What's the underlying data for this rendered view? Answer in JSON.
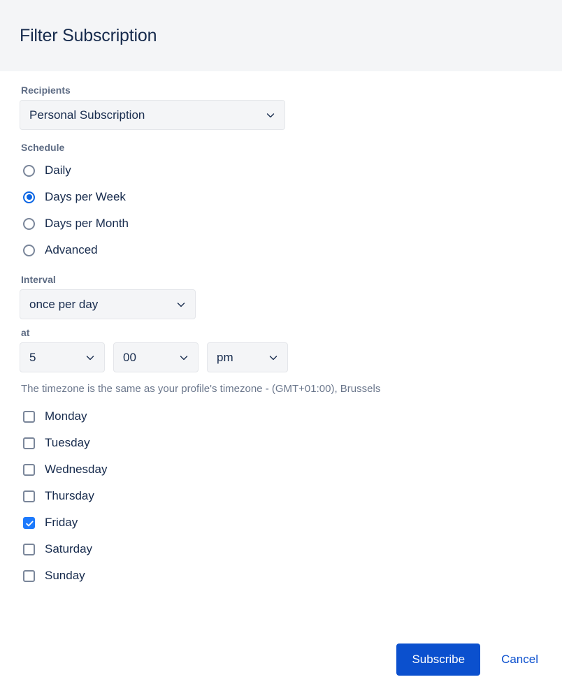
{
  "dialog": {
    "title": "Filter Subscription"
  },
  "recipients": {
    "label": "Recipients",
    "value": "Personal Subscription",
    "options": [
      "Personal Subscription"
    ]
  },
  "schedule": {
    "label": "Schedule",
    "selected": "Days per Week",
    "options": [
      {
        "label": "Daily",
        "checked": false
      },
      {
        "label": "Days per Week",
        "checked": true
      },
      {
        "label": "Days per Month",
        "checked": false
      },
      {
        "label": "Advanced",
        "checked": false
      }
    ]
  },
  "interval": {
    "label": "Interval",
    "value": "once per day",
    "options": [
      "once per day"
    ]
  },
  "time": {
    "label": "at",
    "hour": "5",
    "minute": "00",
    "meridiem": "pm",
    "hour_options": [
      "5"
    ],
    "minute_options": [
      "00"
    ],
    "meridiem_options": [
      "pm"
    ]
  },
  "timezone_note": "The timezone is the same as your profile's timezone - (GMT+01:00), Brussels",
  "days": [
    {
      "label": "Monday",
      "checked": false
    },
    {
      "label": "Tuesday",
      "checked": false
    },
    {
      "label": "Wednesday",
      "checked": false
    },
    {
      "label": "Thursday",
      "checked": false
    },
    {
      "label": "Friday",
      "checked": true
    },
    {
      "label": "Saturday",
      "checked": false
    },
    {
      "label": "Sunday",
      "checked": false
    }
  ],
  "footer": {
    "submit_label": "Subscribe",
    "cancel_label": "Cancel"
  },
  "colors": {
    "accent": "#0b50ce",
    "radio_selected": "#0c66e4",
    "checkbox_checked": "#1d7afc",
    "header_bg": "#f4f5f7",
    "text_primary": "#172b4d",
    "label_text": "#5e6c84",
    "muted_text": "#6b778c"
  }
}
